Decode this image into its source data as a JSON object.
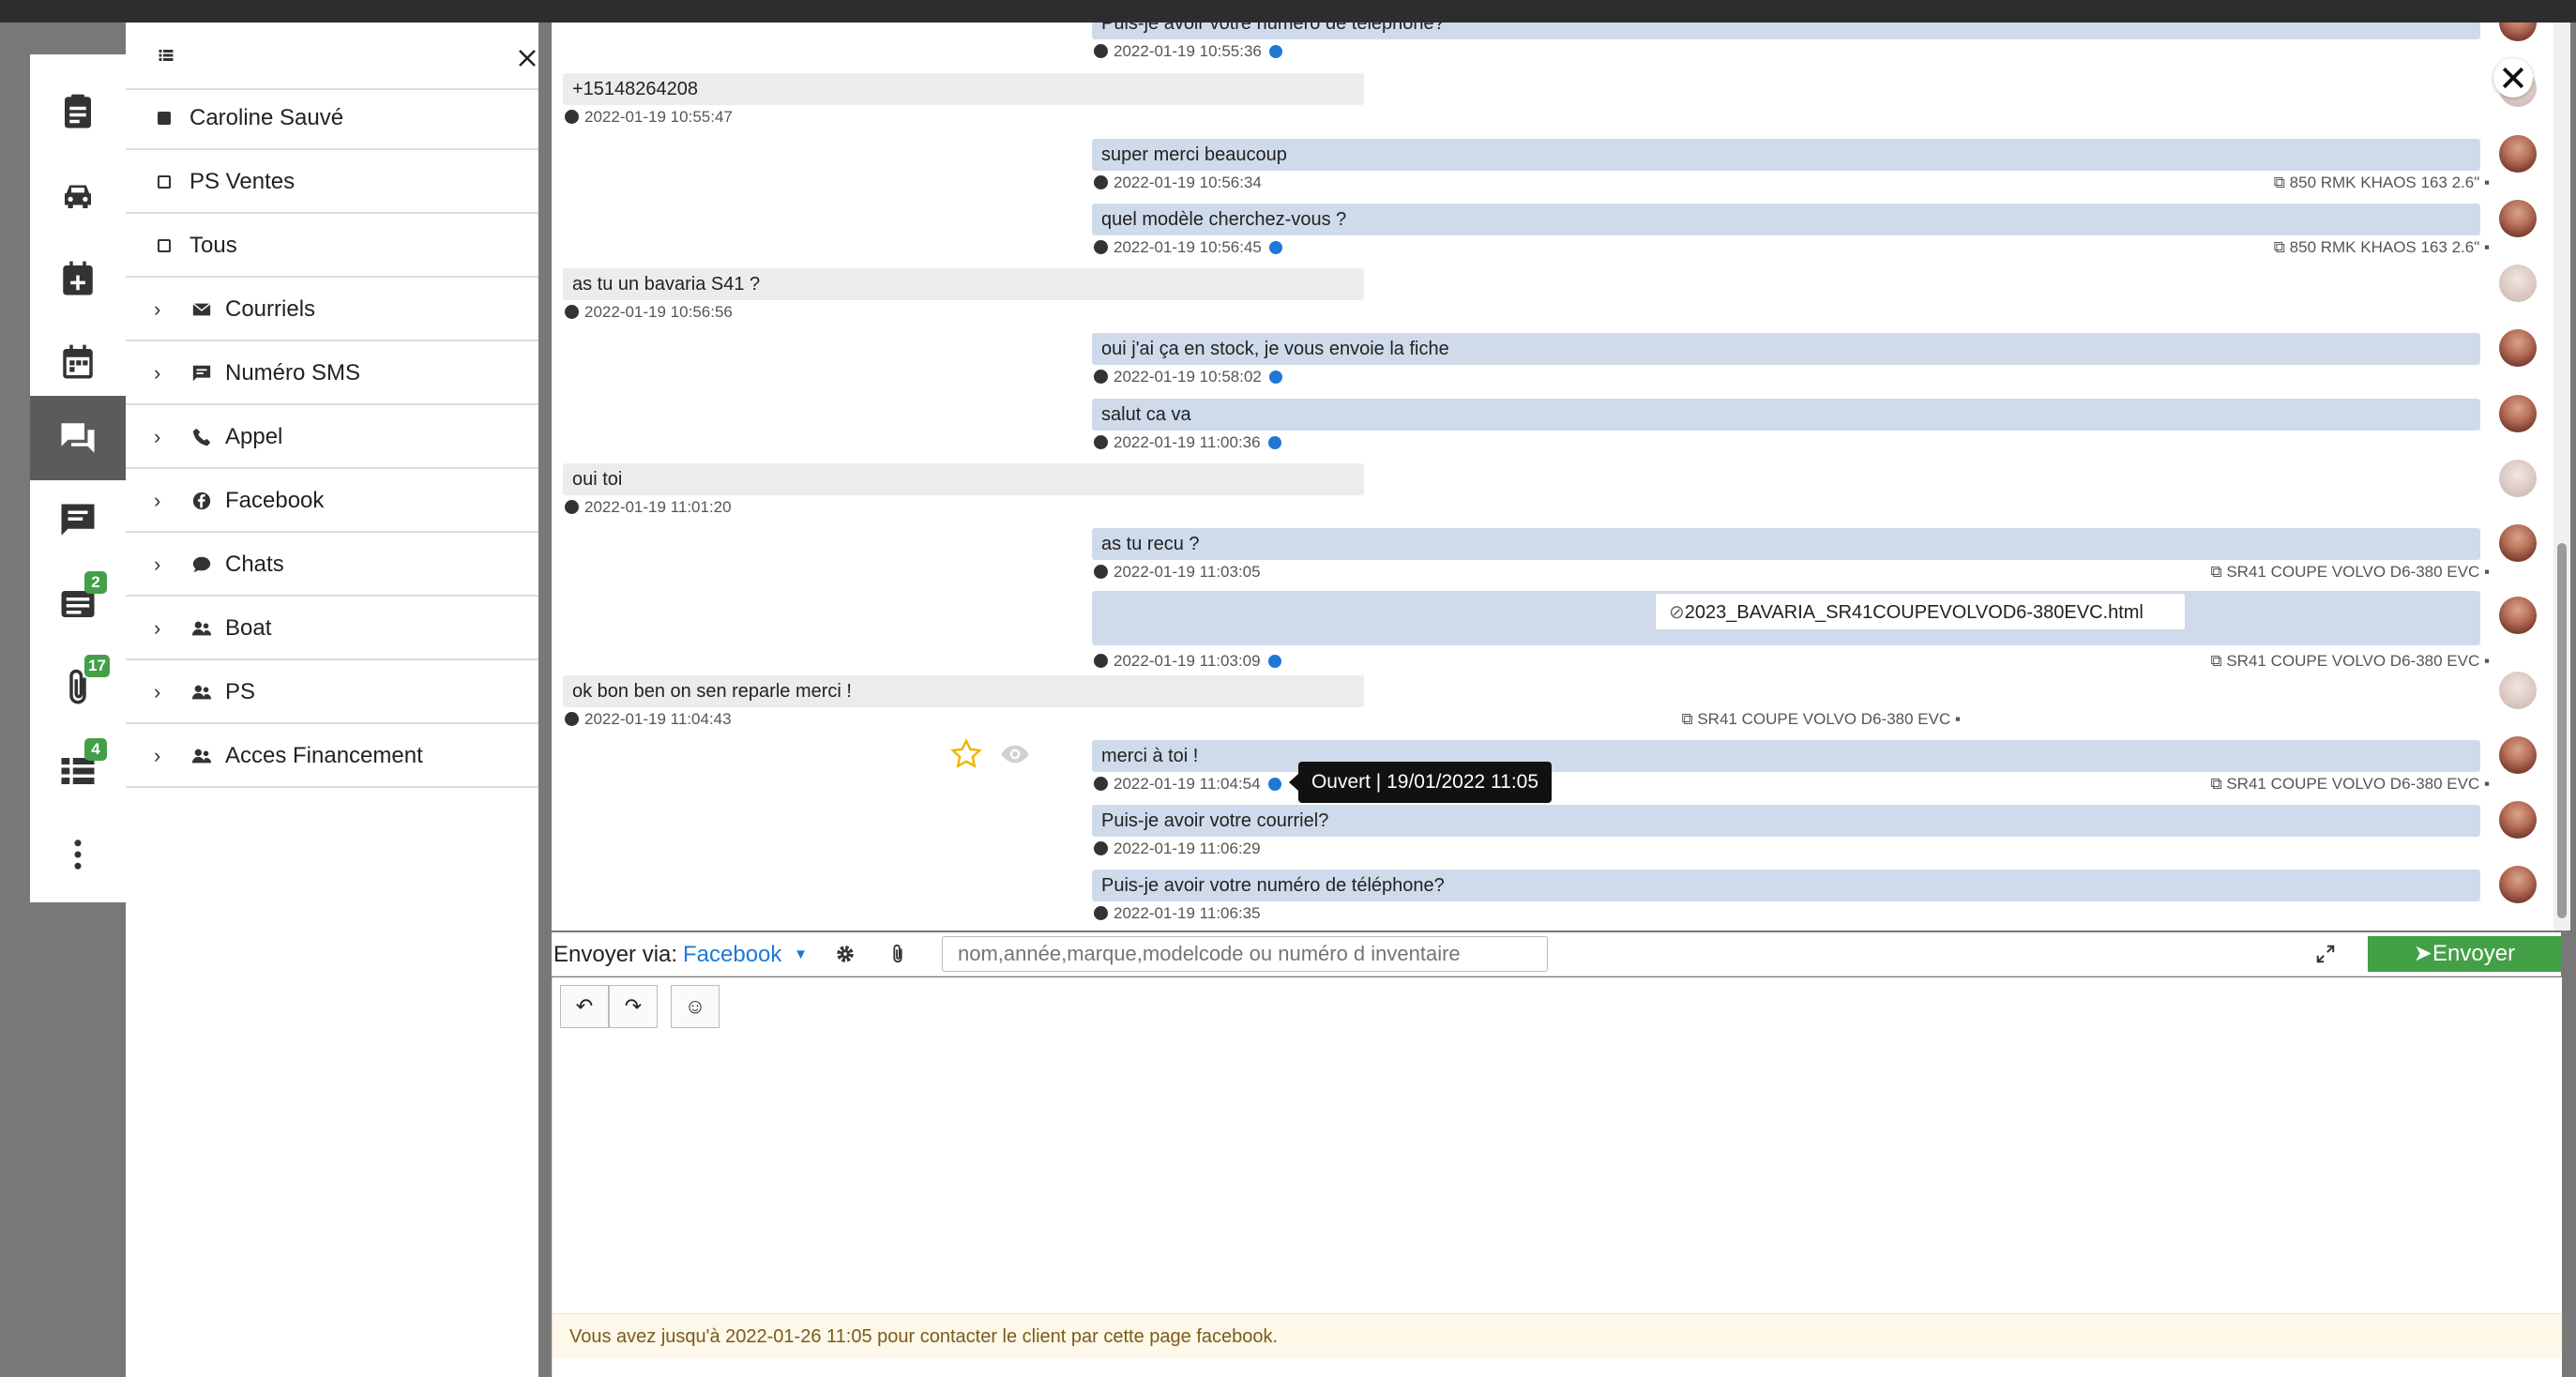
{
  "sidebar": {
    "checkbox_items": [
      {
        "label": "Caroline Sauvé",
        "checked": true
      },
      {
        "label": "PS Ventes",
        "checked": false
      },
      {
        "label": "Tous",
        "checked": false
      }
    ],
    "groups": [
      {
        "label": "Courriels",
        "icon": "envelope-icon"
      },
      {
        "label": "Numéro SMS",
        "icon": "sms-icon"
      },
      {
        "label": "Appel",
        "icon": "phone-icon"
      },
      {
        "label": "Facebook",
        "icon": "facebook-icon"
      },
      {
        "label": "Chats",
        "icon": "chat-bubble-icon"
      },
      {
        "label": "Boat",
        "icon": "users-icon"
      },
      {
        "label": "PS",
        "icon": "users-icon"
      },
      {
        "label": "Acces Financement",
        "icon": "users-icon"
      }
    ]
  },
  "rail": {
    "badges": {
      "notes": "2",
      "attachments": "17",
      "tasks": "4"
    }
  },
  "messages": [
    {
      "dir": "out",
      "text": "Puis-je avoir votre numéro de téléphone?",
      "time": "2022-01-19 10:55:36",
      "info": true,
      "ref": ""
    },
    {
      "dir": "in",
      "text": "+15148264208",
      "time": "2022-01-19 10:55:47",
      "info": false,
      "ref": ""
    },
    {
      "dir": "out",
      "text": "super merci beaucoup",
      "time": "2022-01-19 10:56:34",
      "info": false,
      "ref": "850 RMK KHAOS 163 2.6\""
    },
    {
      "dir": "out",
      "text": "quel modèle cherchez-vous ?",
      "time": "2022-01-19 10:56:45",
      "info": true,
      "ref": "850 RMK KHAOS 163 2.6\""
    },
    {
      "dir": "in",
      "text": "as tu un bavaria S41 ?",
      "time": "2022-01-19 10:56:56",
      "info": false,
      "ref": ""
    },
    {
      "dir": "out",
      "text": "oui j'ai ça en stock, je vous envoie la fiche",
      "time": "2022-01-19 10:58:02",
      "info": true,
      "ref": ""
    },
    {
      "dir": "out",
      "text": "salut ca va",
      "time": "2022-01-19 11:00:36",
      "info": true,
      "ref": ""
    },
    {
      "dir": "in",
      "text": "oui toi",
      "time": "2022-01-19 11:01:20",
      "info": false,
      "ref": ""
    },
    {
      "dir": "out",
      "text": "as tu recu ?",
      "time": "2022-01-19 11:03:05",
      "info": false,
      "ref": "SR41 COUPE VOLVO D6-380 EVC"
    },
    {
      "dir": "out",
      "text": "",
      "attachment": "2023_BAVARIA_SR41COUPEVOLVOD6-380EVC.html",
      "time": "2022-01-19 11:03:09",
      "info": true,
      "ref": "SR41 COUPE VOLVO D6-380 EVC"
    },
    {
      "dir": "in",
      "text": "ok bon ben on sen reparle merci !",
      "time": "2022-01-19 11:04:43",
      "info": false,
      "ref": "SR41 COUPE VOLVO D6-380 EVC"
    },
    {
      "dir": "out",
      "text": "merci à toi !",
      "time": "2022-01-19 11:04:54",
      "info": true,
      "ref": "SR41 COUPE VOLVO D6-380 EVC"
    },
    {
      "dir": "out",
      "text": "Puis-je avoir votre courriel?",
      "time": "2022-01-19 11:06:29",
      "info": false,
      "ref": ""
    },
    {
      "dir": "out",
      "text": "Puis-je avoir votre numéro de téléphone?",
      "time": "2022-01-19 11:06:35",
      "info": false,
      "ref": ""
    }
  ],
  "tooltip": "Ouvert | 19/01/2022 11:05",
  "sendbar": {
    "label": "Envoyer via:",
    "channel": "Facebook",
    "search_placeholder": "nom,année,marque,modelcode ou numéro d inventaire",
    "send_label": "Envoyer"
  },
  "composer": {
    "notice": "Vous avez jusqu'à 2022-01-26 11:05 pour contacter le client par cette page facebook."
  },
  "colors": {
    "send": "#43a047",
    "link": "#1e78d6",
    "outgoing": "#cfdbeb",
    "incoming": "#ececec"
  }
}
